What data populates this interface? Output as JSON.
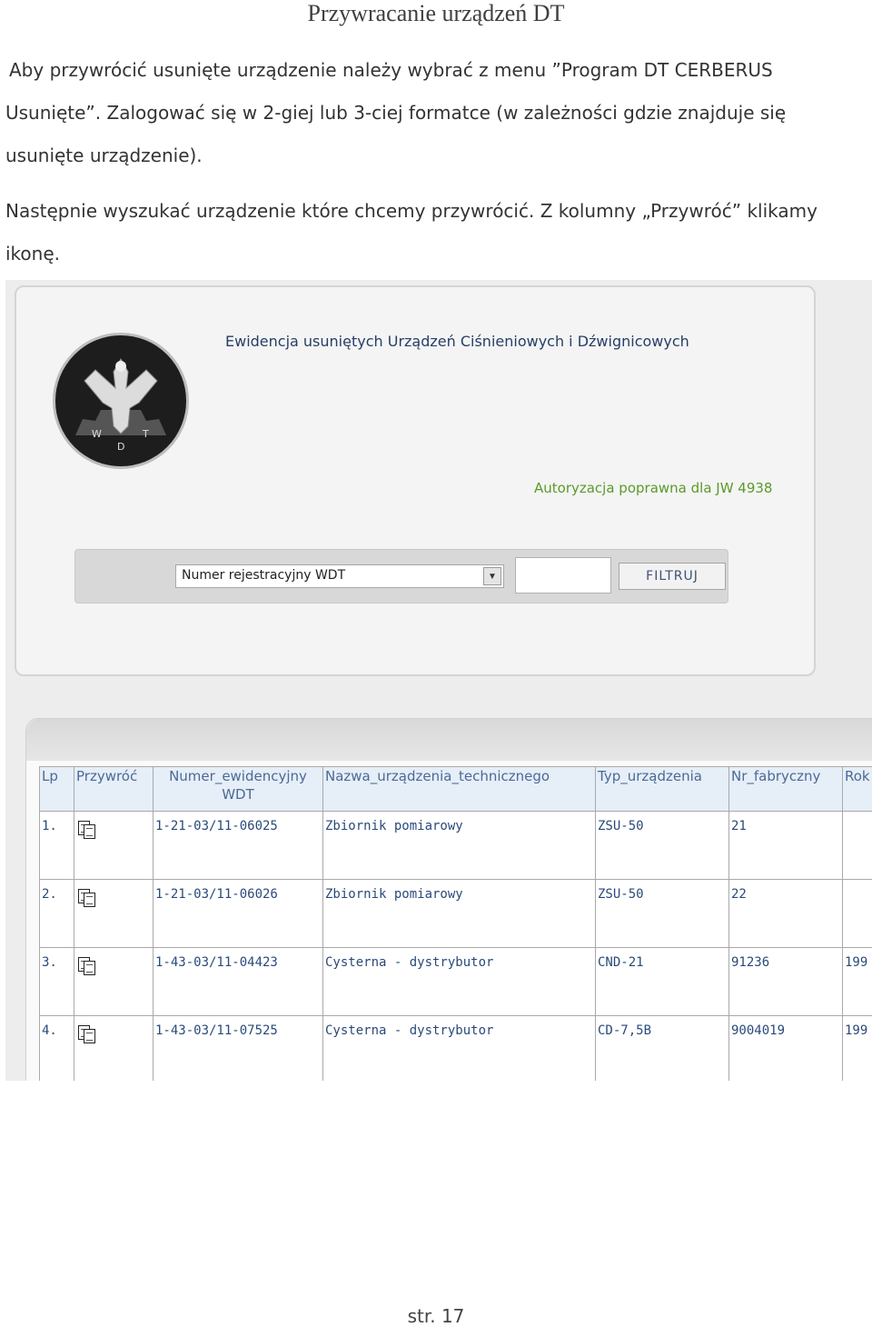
{
  "document": {
    "title": "Przywracanie urządzeń DT",
    "para1_line1": "Aby przywrócić usunięte  urządzenie należy wybrać z menu ”Program DT CERBERUS",
    "para1_line2": "Usunięte”. Zalogować się w 2-giej lub 3-ciej formatce (w zależności gdzie znajduje się",
    "para1_line3": "usunięte urządzenie).",
    "para2_line1": "Następnie wyszukać urządzenie które chcemy przywrócić. Z kolumny „Przywróć” klikamy",
    "para2_line2": "ikonę.",
    "page_number": "str. 17"
  },
  "screenshot": {
    "panel_title": "Ewidencja usuniętych Urządzeń Ciśnieniowych i Dźwignicowych",
    "auth_message": "Autoryzacja poprawna dla JW 4938",
    "filter": {
      "selected_option": "Numer rejestracyjny WDT",
      "input_value": "",
      "button_label": "FILTRUJ"
    },
    "logo": {
      "icon": "eagle-emblem",
      "letters": [
        "W",
        "D",
        "T"
      ]
    },
    "table": {
      "headers": {
        "lp": "Lp",
        "restore": "Przywróć",
        "number": "Numer_ewidencyjny",
        "number_sub": "WDT",
        "name": "Nazwa_urządzenia_technicznego",
        "type": "Typ_urządzenia",
        "serial": "Nr_fabryczny",
        "year": "Rok"
      },
      "rows": [
        {
          "lp": "1.",
          "number": "1-21-03/11-06025",
          "name": "Zbiornik pomiarowy",
          "type": "ZSU-50",
          "serial": "21",
          "year": ""
        },
        {
          "lp": "2.",
          "number": "1-21-03/11-06026",
          "name": "Zbiornik pomiarowy",
          "type": "ZSU-50",
          "serial": "22",
          "year": ""
        },
        {
          "lp": "3.",
          "number": "1-43-03/11-04423",
          "name": "Cysterna - dystrybutor",
          "type": "CND-21",
          "serial": "91236",
          "year": "199"
        },
        {
          "lp": "4.",
          "number": "1-43-03/11-07525",
          "name": "Cysterna - dystrybutor",
          "type": "CD-7,5B",
          "serial": "9004019",
          "year": "199"
        }
      ],
      "restore_icon": "copy-document-icon"
    }
  }
}
